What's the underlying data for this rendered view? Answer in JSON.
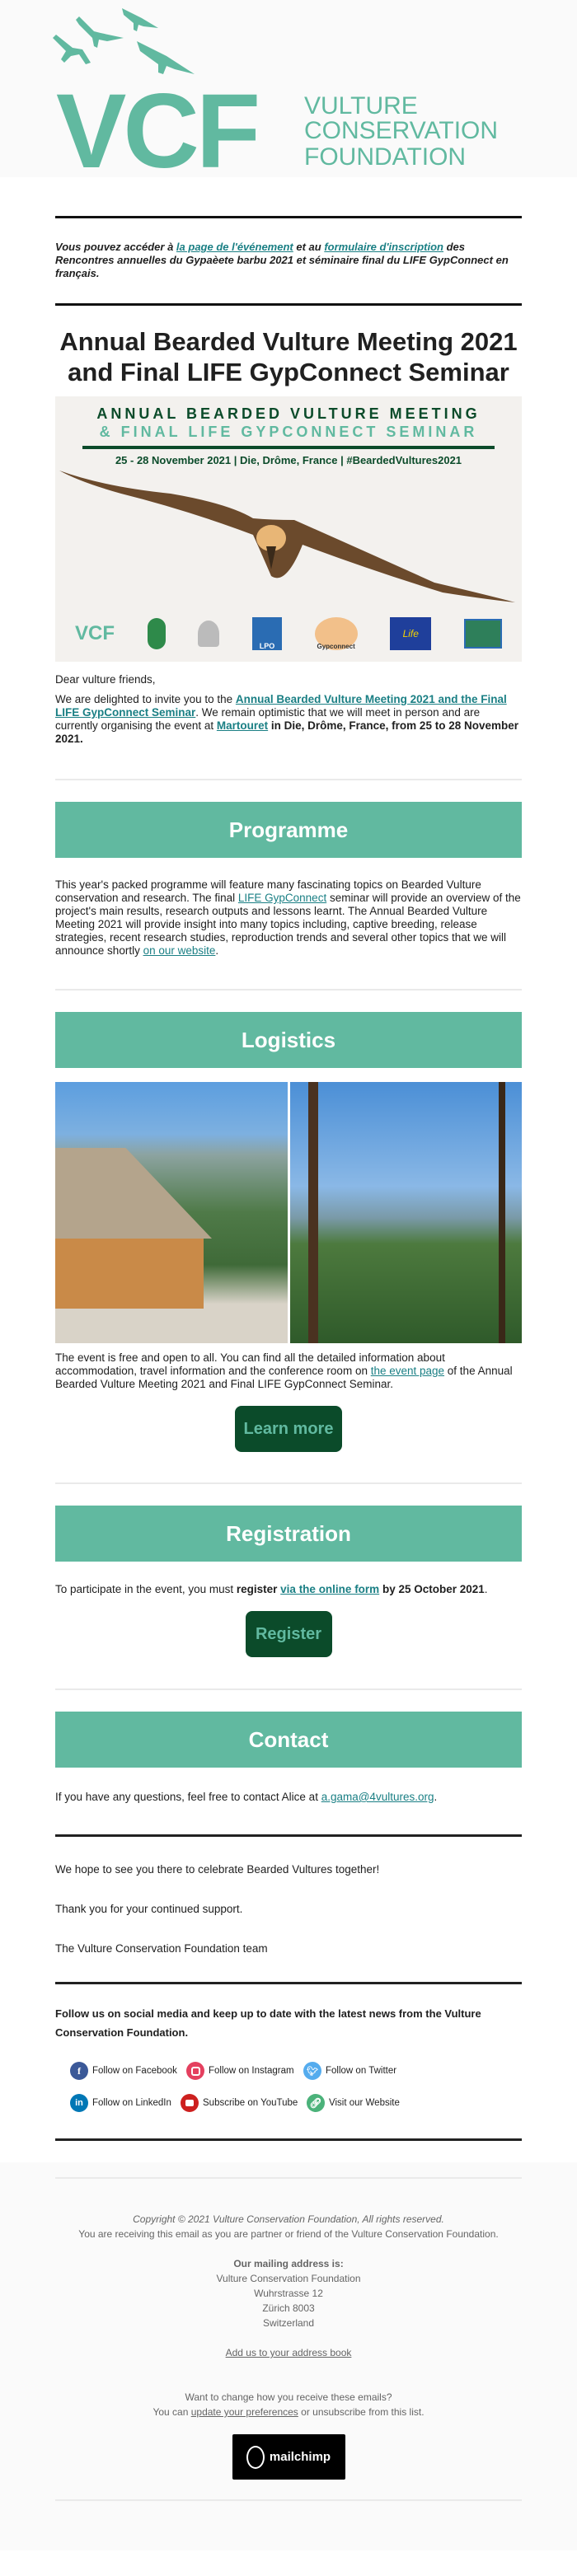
{
  "header": {
    "logo_letters": "VCF",
    "logo_lines": [
      "VULTURE",
      "CONSERVATION",
      "FOUNDATION"
    ],
    "brand_color": "#61b9a0"
  },
  "french_notice": {
    "prefix": "Vous pouvez accéder à ",
    "link1": "la page de l'événement",
    "middle": " et au ",
    "link2": "formulaire d'inscription",
    "suffix": " des Rencontres annuelles du Gypaèete barbu 2021 et séminaire final du LIFE GypConnect en français."
  },
  "title": "Annual Bearded Vulture Meeting 2021 and Final LIFE GypConnect Seminar",
  "banner": {
    "line1": "ANNUAL BEARDED VULTURE MEETING",
    "line2": "& FINAL LIFE GYPCONNECT SEMINAR",
    "details": "25 - 28 November 2021 | Die, Drôme, France | #BeardedVultures2021",
    "partners": [
      "VCF Vulture Conservation Foundation",
      "Parc naturel régional du Vercors",
      "Vautours en Baronnies",
      "LPO",
      "Life Gypconnect",
      "EU Life",
      "Natura 2000"
    ]
  },
  "intro": {
    "greeting": "Dear vulture friends,",
    "p_prefix": "We are delighted to invite you to the ",
    "p_link1": "Annual Bearded Vulture Meeting 2021 and the Final LIFE GypConnect Seminar",
    "p_middle": ". We remain optimistic that we will meet in person and are currently organising the event at ",
    "p_link2": "Martouret",
    "p_bold": " in Die, Drôme, France, from 25 to 28 November 2021."
  },
  "programme": {
    "heading": "Programme",
    "text_prefix": "This year's packed programme will feature many fascinating topics on Bearded Vulture conservation and research. The final ",
    "link1": "LIFE GypConnect",
    "text_middle": " seminar will provide an overview of the project's main results, research outputs and lessons learnt. The Annual Bearded Vulture Meeting 2021 will provide insight into many topics including, captive breeding, release strategies, recent research studies, reproduction trends and several other topics that we will announce shortly ",
    "link2": "on our website",
    "text_suffix": "."
  },
  "logistics": {
    "heading": "Logistics",
    "text_prefix": "The event is free and open to all. You can find all the detailed information about accommodation, travel information and the conference room on ",
    "link": "the event page",
    "text_suffix": " of the Annual Bearded Vulture Meeting 2021 and Final LIFE GypConnect Seminar.",
    "button": "Learn more"
  },
  "registration": {
    "heading": "Registration",
    "text_prefix": "To participate in the event, you must ",
    "bold1": "register",
    "link": "via the online form",
    "bold2": " by 25 October 2021",
    "text_suffix": ".",
    "button": "Register"
  },
  "contact": {
    "heading": "Contact",
    "text_prefix": "If you have any questions, feel free to contact Alice at ",
    "email": "a.gama@4vultures.org",
    "text_suffix": "."
  },
  "closing": {
    "line1": "We hope to see you there to celebrate Bearded Vultures together!",
    "line2": "Thank you for your continued support.",
    "line3": "The Vulture Conservation Foundation team"
  },
  "social": {
    "intro": "Follow us on social media and keep up to date with the latest news from the Vulture Conservation Foundation.",
    "items": [
      {
        "label": "Follow on Facebook",
        "icon": "facebook-icon",
        "color": "#3b5998"
      },
      {
        "label": "Follow on Instagram",
        "icon": "instagram-icon",
        "color": "#e4405f"
      },
      {
        "label": "Follow on Twitter",
        "icon": "twitter-icon",
        "color": "#55acee"
      },
      {
        "label": "Follow on LinkedIn",
        "icon": "linkedin-icon",
        "color": "#0077b5"
      },
      {
        "label": "Subscribe on YouTube",
        "icon": "youtube-icon",
        "color": "#cd201f"
      },
      {
        "label": "Visit our Website",
        "icon": "link-icon",
        "color": "#4bb27a"
      }
    ]
  },
  "footer": {
    "copyright": "Copyright © 2021 Vulture Conservation Foundation, All rights reserved.",
    "reason": "You are receiving this email as you are partner or friend of the Vulture Conservation Foundation.",
    "address_label": "Our mailing address is:",
    "address_lines": [
      "Vulture Conservation Foundation",
      "Wuhrstrasse 12",
      "Zürich 8003",
      "Switzerland"
    ],
    "address_book_link": "Add us to your address book",
    "change_line": "Want to change how you receive these emails?",
    "pref_prefix": "You can ",
    "pref_link": "update your preferences",
    "pref_suffix": " or unsubscribe from this list.",
    "badge": "mailchimp"
  }
}
